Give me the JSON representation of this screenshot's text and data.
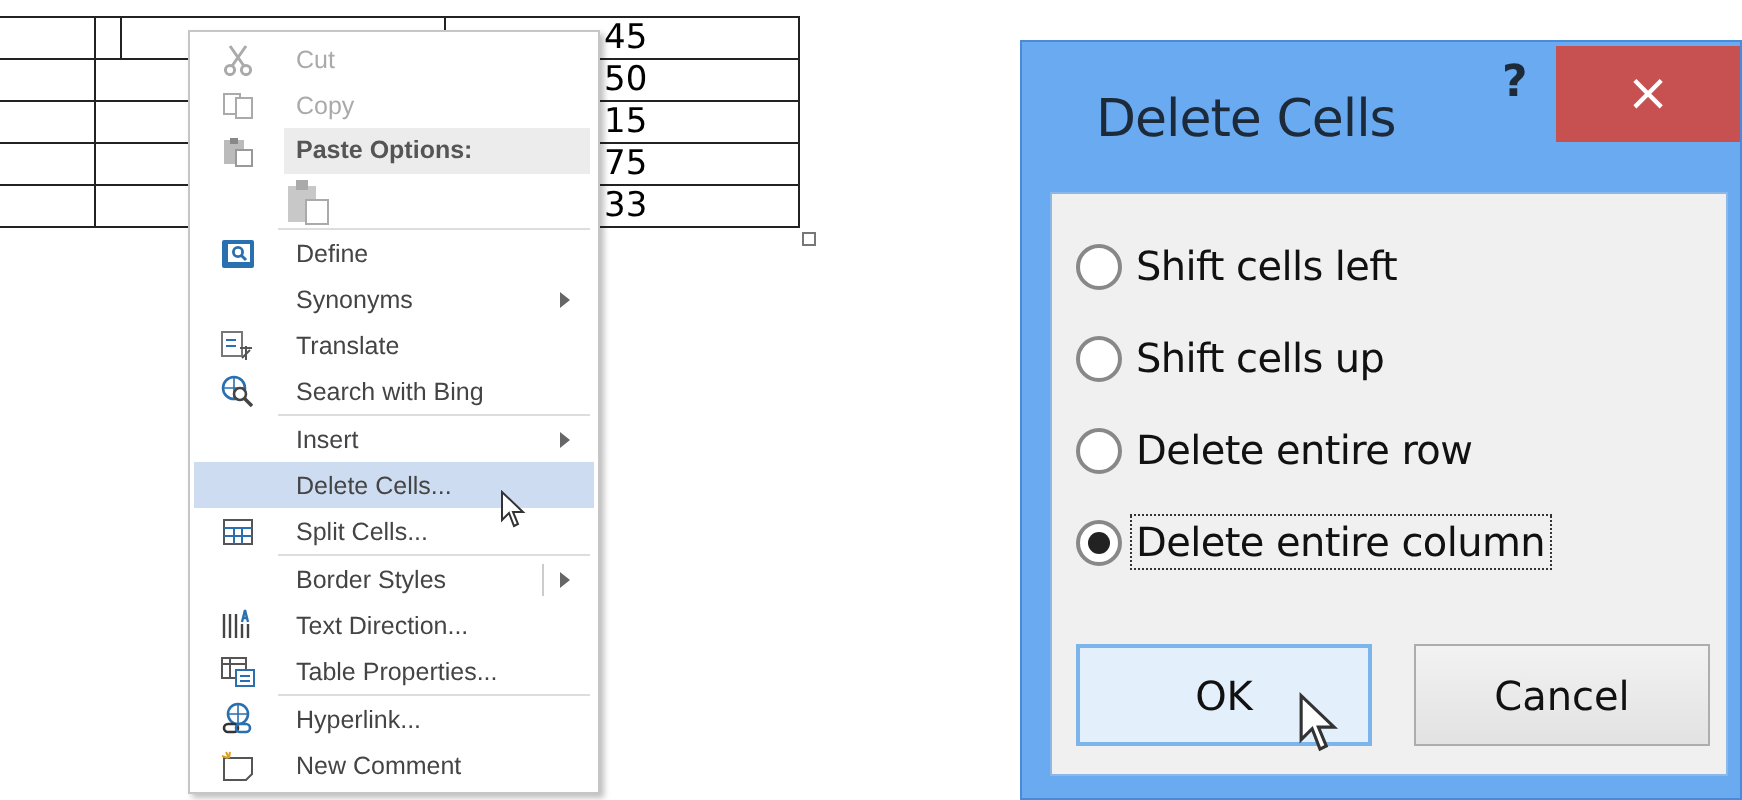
{
  "table": {
    "rows": [
      {
        "value": "45",
        "split": true
      },
      {
        "value": "50",
        "split": false
      },
      {
        "value": "15",
        "split": false
      },
      {
        "value": "75",
        "split": false
      },
      {
        "value": "33",
        "split": false
      }
    ]
  },
  "context_menu": {
    "groups": [
      [
        {
          "kind": "cut",
          "label": "Cut",
          "disabled": true,
          "submenu": false,
          "selected": false
        },
        {
          "kind": "copy",
          "label": "Copy",
          "disabled": true,
          "submenu": false,
          "selected": false
        },
        {
          "kind": "header",
          "label": "Paste Options:"
        },
        {
          "kind": "paste-buttons"
        }
      ],
      [
        {
          "kind": "define",
          "label": "Define",
          "disabled": false,
          "submenu": false,
          "selected": false
        },
        {
          "kind": "plain",
          "label": "Synonyms",
          "disabled": false,
          "submenu": true,
          "selected": false
        },
        {
          "kind": "translate",
          "label": "Translate",
          "disabled": false,
          "submenu": false,
          "selected": false
        },
        {
          "kind": "search",
          "label": "Search with Bing",
          "disabled": false,
          "submenu": false,
          "selected": false
        }
      ],
      [
        {
          "kind": "plain",
          "label": "Insert",
          "disabled": false,
          "submenu": true,
          "selected": false
        },
        {
          "kind": "plain",
          "label": "Delete Cells...",
          "disabled": false,
          "submenu": false,
          "selected": true
        },
        {
          "kind": "split",
          "label": "Split Cells...",
          "disabled": false,
          "submenu": false,
          "selected": false
        }
      ],
      [
        {
          "kind": "plain",
          "label": "Border Styles",
          "disabled": false,
          "submenu": true,
          "split_submenu": true,
          "selected": false
        },
        {
          "kind": "text-direction",
          "label": "Text Direction...",
          "disabled": false,
          "submenu": false,
          "selected": false
        },
        {
          "kind": "table-properties",
          "label": "Table Properties...",
          "disabled": false,
          "submenu": false,
          "selected": false
        }
      ],
      [
        {
          "kind": "hyperlink",
          "label": "Hyperlink...",
          "disabled": false,
          "submenu": false,
          "selected": false
        },
        {
          "kind": "comment",
          "label": "New Comment",
          "disabled": false,
          "submenu": false,
          "selected": false
        }
      ]
    ]
  },
  "dialog": {
    "title": "Delete Cells",
    "help": "?",
    "close": "×",
    "options": [
      {
        "label": "Shift cells left",
        "selected": false,
        "focused": false
      },
      {
        "label": "Shift cells up",
        "selected": false,
        "focused": false
      },
      {
        "label": "Delete entire row",
        "selected": false,
        "focused": false
      },
      {
        "label": "Delete entire column",
        "selected": true,
        "focused": true
      }
    ],
    "buttons": [
      {
        "label": "OK",
        "default": true
      },
      {
        "label": "Cancel",
        "default": false
      }
    ]
  }
}
